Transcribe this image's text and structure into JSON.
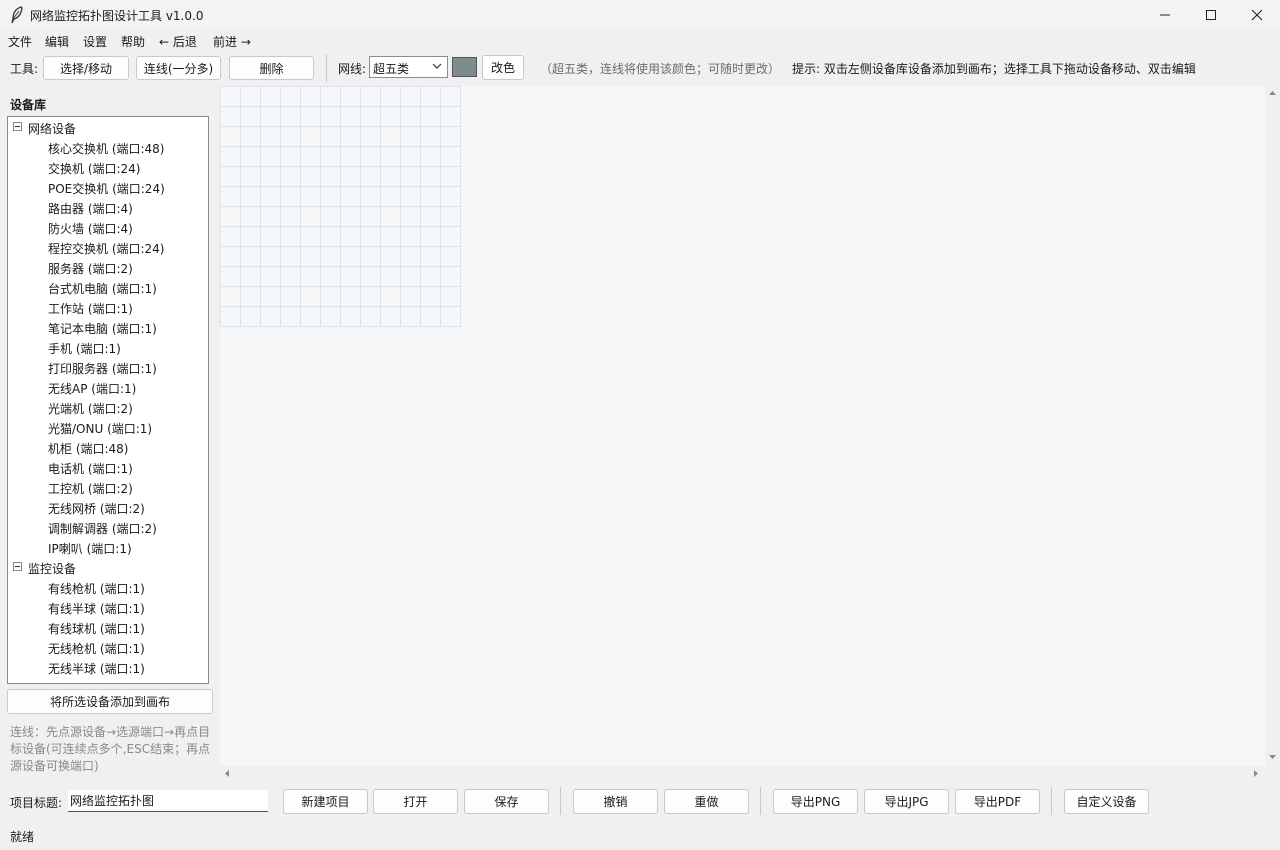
{
  "window": {
    "title": "网络监控拓扑图设计工具  v1.0.0"
  },
  "menu": {
    "items": [
      "文件",
      "编辑",
      "设置",
      "帮助",
      "← 后退",
      "前进 →"
    ]
  },
  "toolbar": {
    "tool_label": "工具:",
    "select_move": "选择/移动",
    "connect": "连线(一分多)",
    "delete": "删除",
    "cable_label": "网线:",
    "cable_value": "超五类",
    "cable_color": "#7f8c8d",
    "recolor": "改色",
    "cable_note": "（超五类，连线将使用该颜色；可随时更改）",
    "hint": "提示: 双击左侧设备库设备添加到画布；选择工具下拖动设备移动、双击编辑"
  },
  "library": {
    "title": "设备库",
    "groups": [
      {
        "label": "网络设备",
        "items": [
          "核心交换机  (端口:48)",
          "交换机  (端口:24)",
          "POE交换机  (端口:24)",
          "路由器  (端口:4)",
          "防火墙  (端口:4)",
          "程控交换机  (端口:24)",
          "服务器  (端口:2)",
          "台式机电脑  (端口:1)",
          "工作站  (端口:1)",
          "笔记本电脑  (端口:1)",
          "手机  (端口:1)",
          "打印服务器  (端口:1)",
          "无线AP  (端口:1)",
          "光端机  (端口:2)",
          "光猫/ONU  (端口:1)",
          "机柜  (端口:48)",
          "电话机  (端口:1)",
          "工控机  (端口:2)",
          "无线网桥  (端口:2)",
          "调制解调器  (端口:2)",
          "IP喇叭  (端口:1)"
        ]
      },
      {
        "label": "监控设备",
        "items": [
          "有线枪机  (端口:1)",
          "有线半球  (端口:1)",
          "有线球机  (端口:1)",
          "无线枪机  (端口:1)",
          "无线半球  (端口:1)"
        ]
      }
    ],
    "add_button": "将所选设备添加到画布",
    "help": "连线：先点源设备→选源端口→再点目标设备(可连续点多个,ESC结束；再点源设备可换端口)"
  },
  "bottom": {
    "project_label": "项目标题:",
    "project_value": "网络监控拓扑图",
    "new_project": "新建项目",
    "open": "打开",
    "save": "保存",
    "undo": "撤销",
    "redo": "重做",
    "export_png": "导出PNG",
    "export_jpg": "导出JPG",
    "export_pdf": "导出PDF",
    "custom_device": "自定义设备"
  },
  "status": {
    "text": "就绪"
  }
}
